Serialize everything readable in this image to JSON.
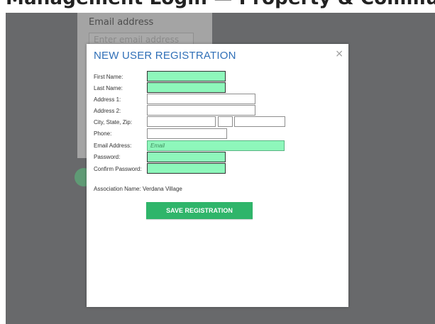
{
  "page_heading": "Management Login — Property & Community Portal",
  "background_form": {
    "email_label": "Email address",
    "email_placeholder": "Enter email address"
  },
  "modal": {
    "title": "NEW USER REGISTRATION",
    "close_glyph": "×",
    "labels": {
      "first_name": "First Name:",
      "last_name": "Last Name:",
      "address1": "Address 1:",
      "address2": "Address 2:",
      "city_state_zip": "City, State, Zip:",
      "phone": "Phone:",
      "email": "Email Address:",
      "password": "Password:",
      "confirm_password": "Confirm Password:"
    },
    "email_placeholder": "Email",
    "association_label": "Association Name:",
    "association_value": "Verdana Village",
    "save_button": "SAVE REGISTRATION"
  },
  "colors": {
    "title_blue": "#2f6fb7",
    "required_field_green": "#8ef7bb",
    "save_button_green": "#2fb56a",
    "overlay_gray": "#68696b"
  }
}
